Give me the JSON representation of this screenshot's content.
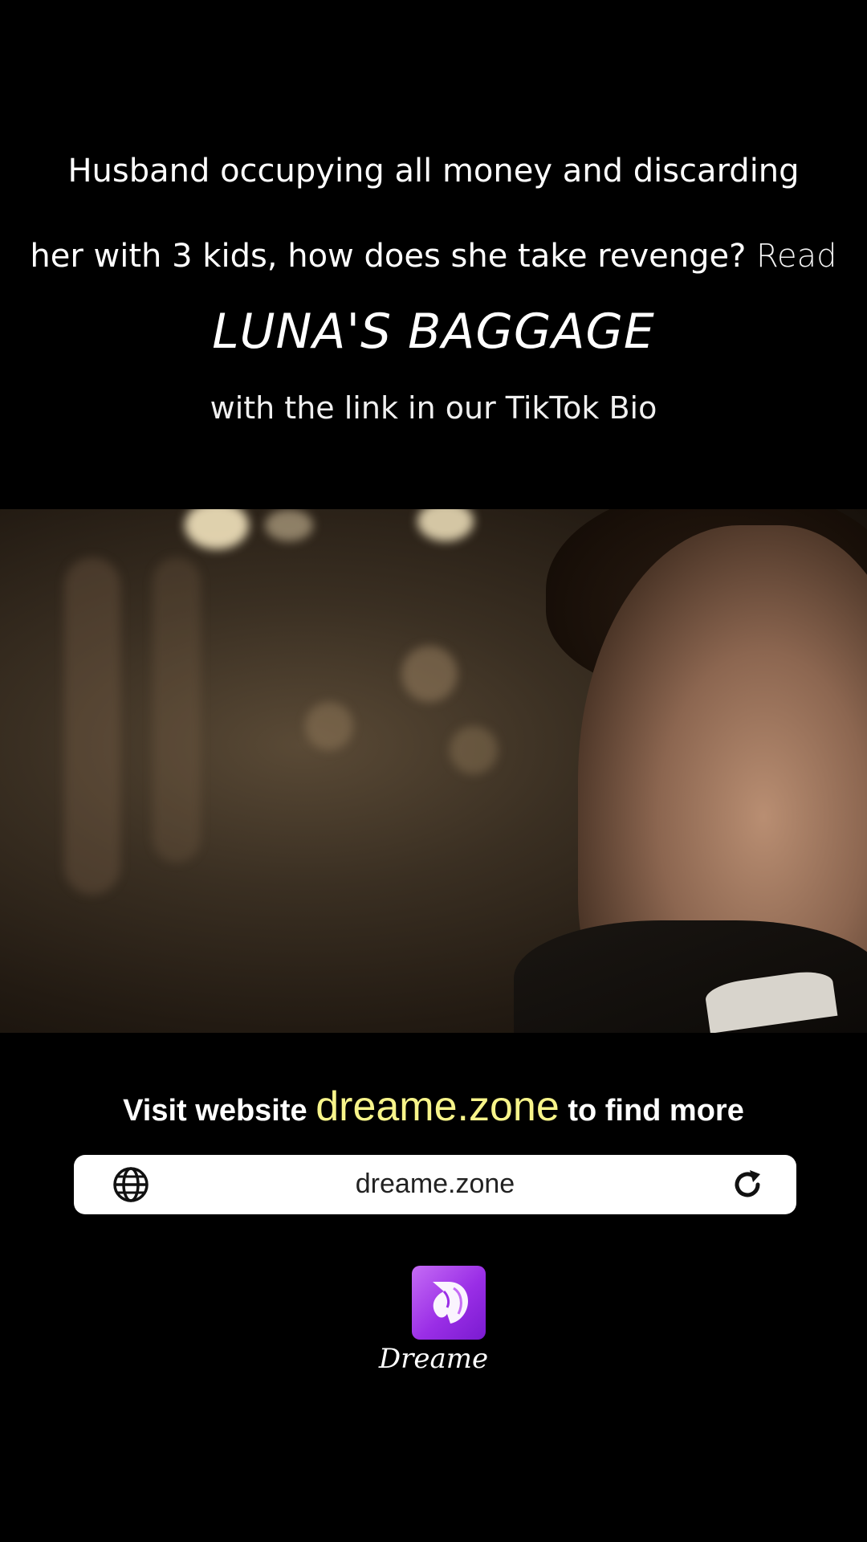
{
  "promo": {
    "line1": "Husband occupying all money and discarding",
    "line2": "her with 3 kids, how does she take revenge?",
    "read_label": "Read",
    "book_title": "LUNA'S BAGGAGE",
    "subtitle": "with the link in our TikTok Bio"
  },
  "cta": {
    "prefix": "Visit website",
    "domain": "dreame.zone",
    "suffix": "to find more"
  },
  "url_bar": {
    "url": "dreame.zone",
    "globe_icon": "globe-icon",
    "reload_icon": "reload-icon"
  },
  "brand": {
    "name": "Dreame",
    "icon": "unicorn-logo-icon",
    "accent": "#9a2ee6",
    "highlight": "#f7f48a"
  }
}
